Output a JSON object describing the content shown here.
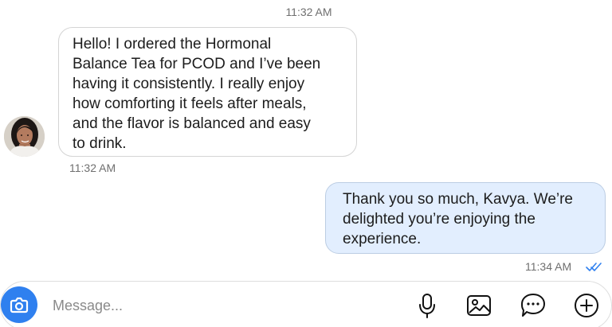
{
  "chat": {
    "top_timestamp": "11:32 AM",
    "incoming": {
      "text": "Hello! I ordered the Hormonal\nBalance Tea for PCOD and I’ve been\nhaving it consistently. I really enjoy\nhow comforting it feels after meals,\nand the flavor is balanced and easy\nto drink.",
      "time": "11:32 AM"
    },
    "outgoing": {
      "text": "Thank you so much, Kavya. We’re\ndelighted you’re enjoying the\nexperience.",
      "time": "11:34 AM",
      "status_icon": "double-check-icon"
    }
  },
  "composer": {
    "placeholder": "Message...",
    "value": "",
    "icons": {
      "camera": "camera-icon",
      "microphone": "microphone-icon",
      "gallery": "gallery-icon",
      "sticker": "chat-bubble-dots-icon",
      "add": "plus-circle-icon"
    }
  },
  "colors": {
    "accent": "#2f80ef",
    "outgoing_bubble": "#e2eefe",
    "incoming_bubble_border": "#d4d4d4",
    "timestamp": "#6f6f6f"
  }
}
